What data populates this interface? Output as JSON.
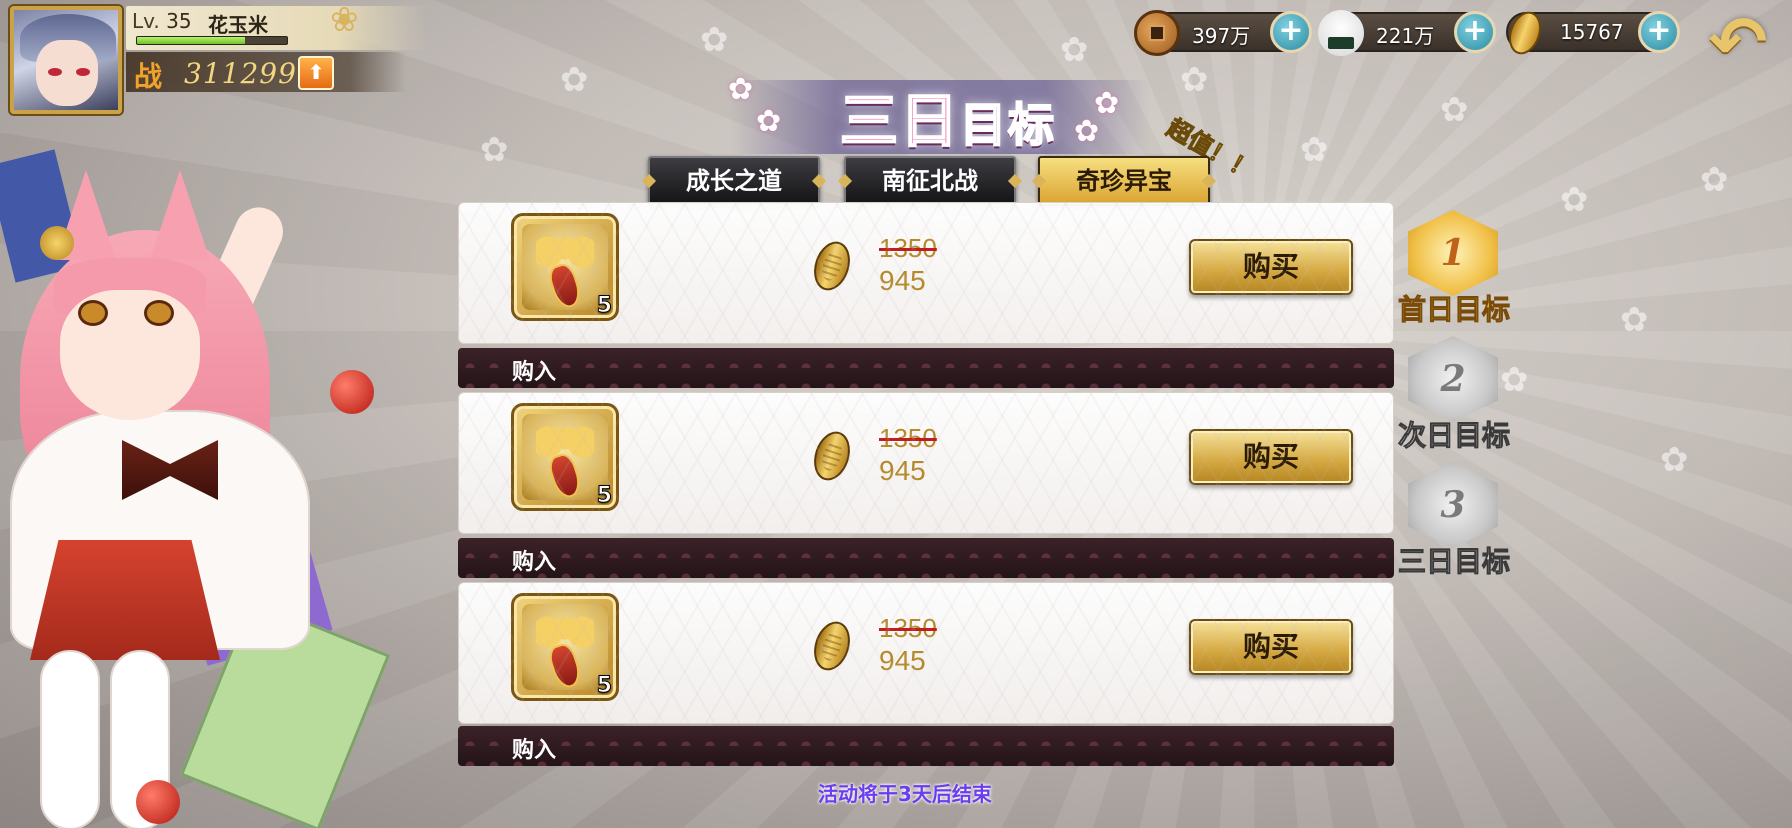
{
  "player": {
    "level_prefix": "Lv.",
    "level": "35",
    "name": "花玉米",
    "power_label": "战",
    "power_value": "311299",
    "exp_progress": 0.72
  },
  "currencies": [
    {
      "icon": "copper-coin-icon",
      "value": "397万"
    },
    {
      "icon": "rice-ball-icon",
      "value": "221万"
    },
    {
      "icon": "gold-koban-icon",
      "value": "15767"
    }
  ],
  "title": {
    "main": "三日",
    "sub": "目标",
    "super_tag": "超值！！"
  },
  "tabs": [
    {
      "label": "成长之道",
      "active": false
    },
    {
      "label": "南征北战",
      "active": false
    },
    {
      "label": "奇珍异宝",
      "active": true
    }
  ],
  "offers": [
    {
      "item_icon": "golden-bell-staff-icon",
      "count": "5",
      "old_price": "1350",
      "new_price": "945",
      "button": "购买",
      "footer": "购入"
    },
    {
      "item_icon": "golden-bell-staff-icon",
      "count": "5",
      "old_price": "1350",
      "new_price": "945",
      "button": "购买",
      "footer": "购入"
    },
    {
      "item_icon": "golden-bell-staff-icon",
      "count": "5",
      "old_price": "1350",
      "new_price": "945",
      "button": "购买",
      "footer": "购入"
    }
  ],
  "day_targets": [
    {
      "number": "1",
      "label": "首日目标",
      "active": true
    },
    {
      "number": "2",
      "label": "次日目标",
      "active": false
    },
    {
      "number": "3",
      "label": "三日目标",
      "active": false
    }
  ],
  "end_note": "活动将于3天后结束",
  "colors": {
    "gold": "#d7ab45",
    "price": "#b48a2c",
    "strike": "#c21d1d",
    "note": "#6b3df0",
    "title_pink": "#f06aa8"
  }
}
